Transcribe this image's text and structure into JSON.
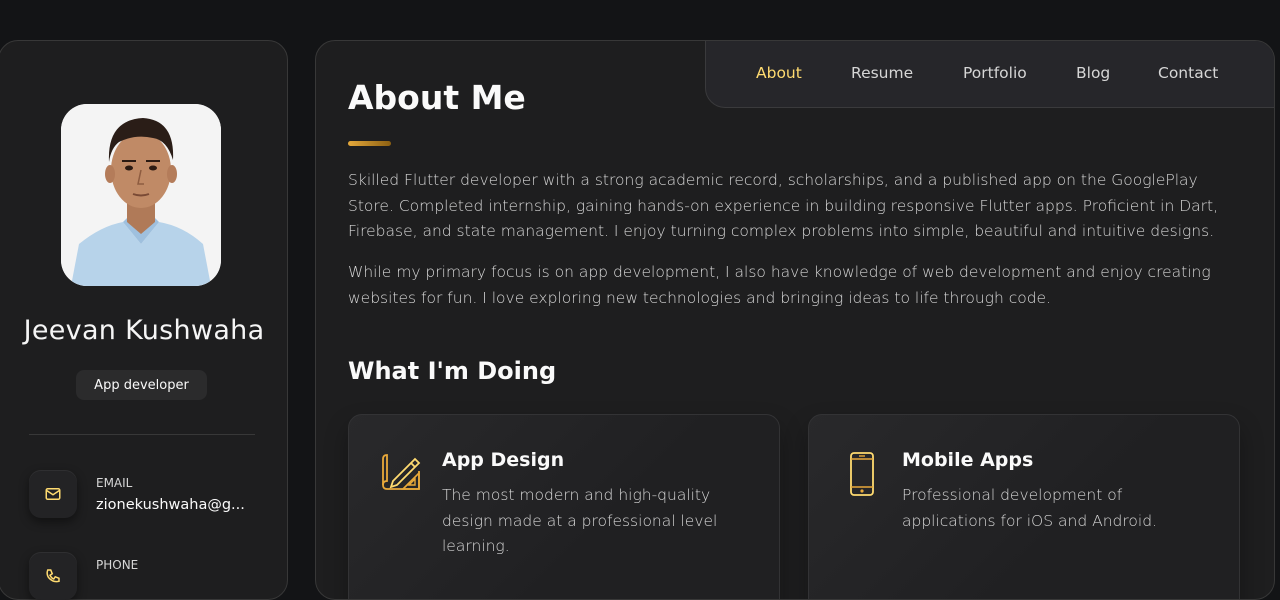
{
  "profile": {
    "name": "Jeevan Kushwaha",
    "role": "App developer",
    "avatar_alt": "Profile photo"
  },
  "contacts": [
    {
      "icon": "mail-icon",
      "title": "EMAIL",
      "value": "zionekushwaha@g..."
    },
    {
      "icon": "phone-icon",
      "title": "PHONE",
      "value": ""
    }
  ],
  "nav": {
    "items": [
      {
        "label": "About",
        "active": true
      },
      {
        "label": "Resume",
        "active": false
      },
      {
        "label": "Portfolio",
        "active": false
      },
      {
        "label": "Blog",
        "active": false
      },
      {
        "label": "Contact",
        "active": false
      }
    ]
  },
  "about": {
    "title": "About Me",
    "paragraphs": [
      "Skilled Flutter developer with a strong academic record, scholarships, and a published app on the GooglePlay Store. Completed internship, gaining hands-on experience in building responsive Flutter apps. Proficient in Dart, Firebase, and state management. I enjoy turning complex problems into simple, beautiful and intuitive designs.",
      "While my primary focus is on app development, I also have knowledge of web development and enjoy creating websites for fun. I love exploring new technologies and bringing ideas to life through code."
    ]
  },
  "services": {
    "title": "What I'm Doing",
    "items": [
      {
        "icon": "design-pencil-icon",
        "title": "App Design",
        "text": "The most modern and high-quality design made at a professional level learning."
      },
      {
        "icon": "mobile-phone-icon",
        "title": "Mobile Apps",
        "text": "Professional development of applications for iOS and Android."
      }
    ]
  },
  "colors": {
    "accent": "#ffdb70",
    "background": "#131416",
    "card": "#1e1e1f"
  }
}
